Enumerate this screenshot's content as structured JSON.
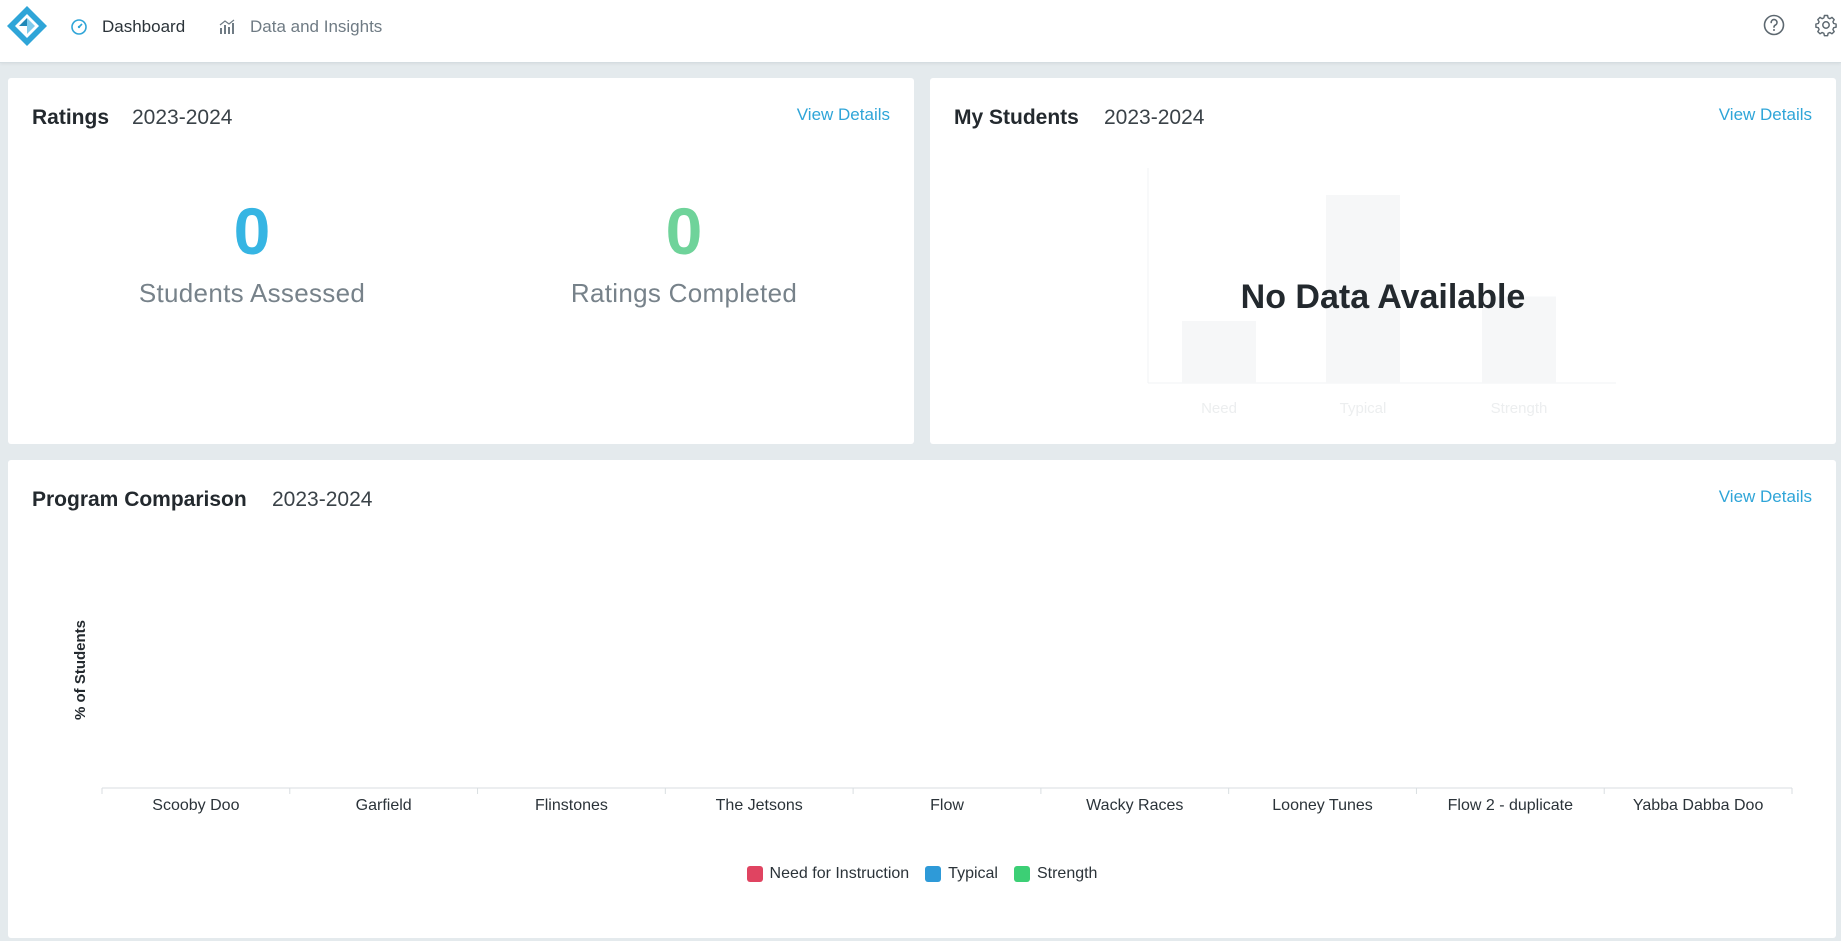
{
  "nav": {
    "dashboard_label": "Dashboard",
    "insights_label": "Data and Insights",
    "brand_color": "#2fa5d8"
  },
  "ratings": {
    "title": "Ratings",
    "year": "2023-2024",
    "view_details": "View Details",
    "students_assessed_value": "0",
    "students_assessed_label": "Students Assessed",
    "ratings_completed_value": "0",
    "ratings_completed_label": "Ratings Completed",
    "colors": {
      "assessed": "#36b5e3",
      "completed": "#6fd39a"
    }
  },
  "my_students": {
    "title": "My Students",
    "year": "2023-2024",
    "view_details": "View Details",
    "no_data": "No Data Available",
    "placeholder_categories": [
      "Need",
      "Typical",
      "Strength"
    ],
    "placeholder_values": [
      0.33,
      1.0,
      0.46
    ]
  },
  "program_comparison": {
    "title": "Program Comparison",
    "year": "2023-2024",
    "view_details": "View Details"
  },
  "chart_data": {
    "type": "bar",
    "ylabel": "% of Students",
    "xlabel": "",
    "categories": [
      "Scooby Doo",
      "Garfield",
      "Flinstones",
      "The Jetsons",
      "Flow",
      "Wacky Races",
      "Looney Tunes",
      "Flow 2 - duplicate",
      "Yabba Dabba Doo"
    ],
    "series": [
      {
        "name": "Need for Instruction",
        "color": "#e04461",
        "values": [
          0,
          0,
          0,
          0,
          0,
          0,
          0,
          0,
          0
        ]
      },
      {
        "name": "Typical",
        "color": "#2e9ad8",
        "values": [
          0,
          0,
          0,
          0,
          0,
          0,
          0,
          0,
          0
        ]
      },
      {
        "name": "Strength",
        "color": "#3ccf75",
        "values": [
          0,
          0,
          0,
          0,
          0,
          0,
          0,
          0,
          0
        ]
      }
    ],
    "legend": "bottom-center",
    "grid": false
  }
}
